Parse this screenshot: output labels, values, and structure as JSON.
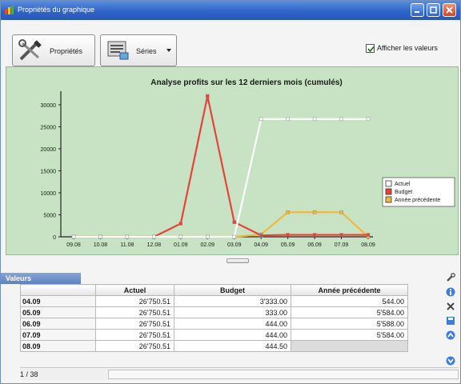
{
  "window": {
    "title": "Propriétés du graphique"
  },
  "toolbar": {
    "properties_label": "Propriétés",
    "series_label": "Séries",
    "show_values_label": "Afficher les valeurs",
    "show_values_checked": true
  },
  "colors": {
    "chart_background": "#c8e3c4",
    "actual": "#ffffff",
    "budget": "#e8423a",
    "previous_year": "#f0b840"
  },
  "chart_data": {
    "type": "line",
    "title": "Analyse profits sur les 12 derniers mois (cumulés)",
    "categories": [
      "09.08",
      "10.08",
      "11.08",
      "12.08",
      "01.09",
      "02.09",
      "03.09",
      "04.09",
      "05.09",
      "06.09",
      "07.09",
      "08.09"
    ],
    "yticks": [
      0,
      5000,
      10000,
      15000,
      20000,
      25000,
      30000
    ],
    "ylim": [
      0,
      32000
    ],
    "legend_position": "right",
    "series": [
      {
        "name": "Actuel",
        "color": "#ffffff",
        "values": [
          0,
          0,
          0,
          0,
          0,
          0,
          0,
          26750.51,
          26750.51,
          26750.51,
          26750.51,
          26750.51
        ]
      },
      {
        "name": "Budget",
        "color": "#e8423a",
        "values": [
          0,
          0,
          0,
          0,
          3000,
          32000,
          3333,
          333,
          444,
          444,
          444,
          444.5
        ]
      },
      {
        "name": "Année précédente",
        "color": "#f0b840",
        "values": [
          0,
          0,
          0,
          0,
          0,
          0,
          0,
          544,
          5584,
          5588,
          5584,
          0
        ]
      }
    ]
  },
  "values_panel": {
    "title": "Valeurs",
    "columns": [
      "",
      "Actuel",
      "Budget",
      "Année précédente"
    ],
    "rows": [
      [
        "04.09",
        "26'750.51",
        "3'333.00",
        "544.00"
      ],
      [
        "05.09",
        "26'750.51",
        "333.00",
        "5'584.00"
      ],
      [
        "06.09",
        "26'750.51",
        "444.00",
        "5'588.00"
      ],
      [
        "07.09",
        "26'750.51",
        "444.00",
        "5'584.00"
      ],
      [
        "08.09",
        "26'750.51",
        "444.50",
        ""
      ]
    ],
    "page_info": "1 / 38"
  }
}
